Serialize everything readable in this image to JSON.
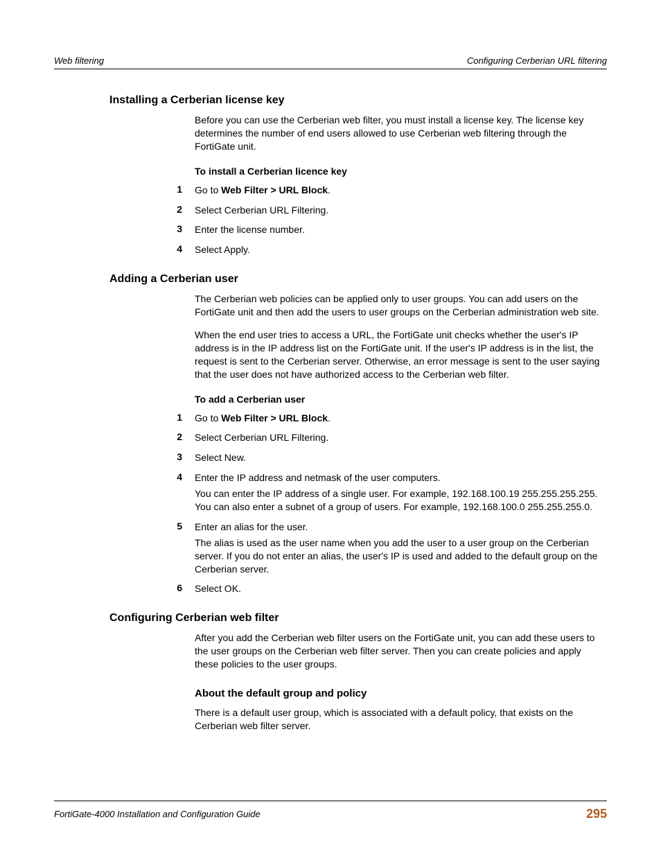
{
  "header": {
    "left": "Web filtering",
    "right": "Configuring Cerberian URL filtering"
  },
  "sections": {
    "s1": {
      "title": "Installing a Cerberian license key",
      "intro": "Before you can use the Cerberian web filter, you must install a license key. The license key determines the number of end users allowed to use Cerberian web filtering through the FortiGate unit.",
      "sub": "To install a Cerberian licence key",
      "steps": {
        "n1": "1",
        "t1a": "Go to ",
        "t1b": "Web Filter > URL Block",
        "t1c": ".",
        "n2": "2",
        "t2": "Select Cerberian URL Filtering.",
        "n3": "3",
        "t3": "Enter the license number.",
        "n4": "4",
        "t4": "Select Apply."
      }
    },
    "s2": {
      "title": "Adding a Cerberian user",
      "intro1": "The Cerberian web policies can be applied only to user groups. You can add users on the FortiGate unit and then add the users to user groups on the Cerberian administration web site.",
      "intro2": "When the end user tries to access a URL, the FortiGate unit checks whether the user's IP address is in the IP address list on the FortiGate unit. If the user's IP address is in the list, the request is sent to the Cerberian server. Otherwise, an error message is sent to the user saying that the user does not have authorized access to the Cerberian web filter.",
      "sub": "To add a Cerberian user",
      "steps": {
        "n1": "1",
        "t1a": "Go to ",
        "t1b": "Web Filter > URL Block",
        "t1c": ".",
        "n2": "2",
        "t2": "Select Cerberian URL Filtering.",
        "n3": "3",
        "t3": "Select New.",
        "n4": "4",
        "t4": "Enter the IP address and netmask of the user computers.",
        "t4extra": "You can enter the IP address of a single user. For example, 192.168.100.19 255.255.255.255. You can also enter a subnet of a group of users. For example, 192.168.100.0 255.255.255.0.",
        "n5": "5",
        "t5": "Enter an alias for the user.",
        "t5extra": "The alias is used as the user name when you add the user to a user group on the Cerberian server. If you do not enter an alias, the user's IP is used and added to the default group on the Cerberian server.",
        "n6": "6",
        "t6": "Select OK."
      }
    },
    "s3": {
      "title": "Configuring Cerberian web filter",
      "intro": "After you add the Cerberian web filter users on the FortiGate unit, you can add these users to the user groups on the Cerberian web filter server. Then you can create policies and apply these policies to the user groups.",
      "subheading": "About the default group and policy",
      "subtext": "There is a default user group, which is associated with a default policy, that exists on the Cerberian web filter server."
    }
  },
  "footer": {
    "left": "FortiGate-4000 Installation and Configuration Guide",
    "page": "295"
  }
}
